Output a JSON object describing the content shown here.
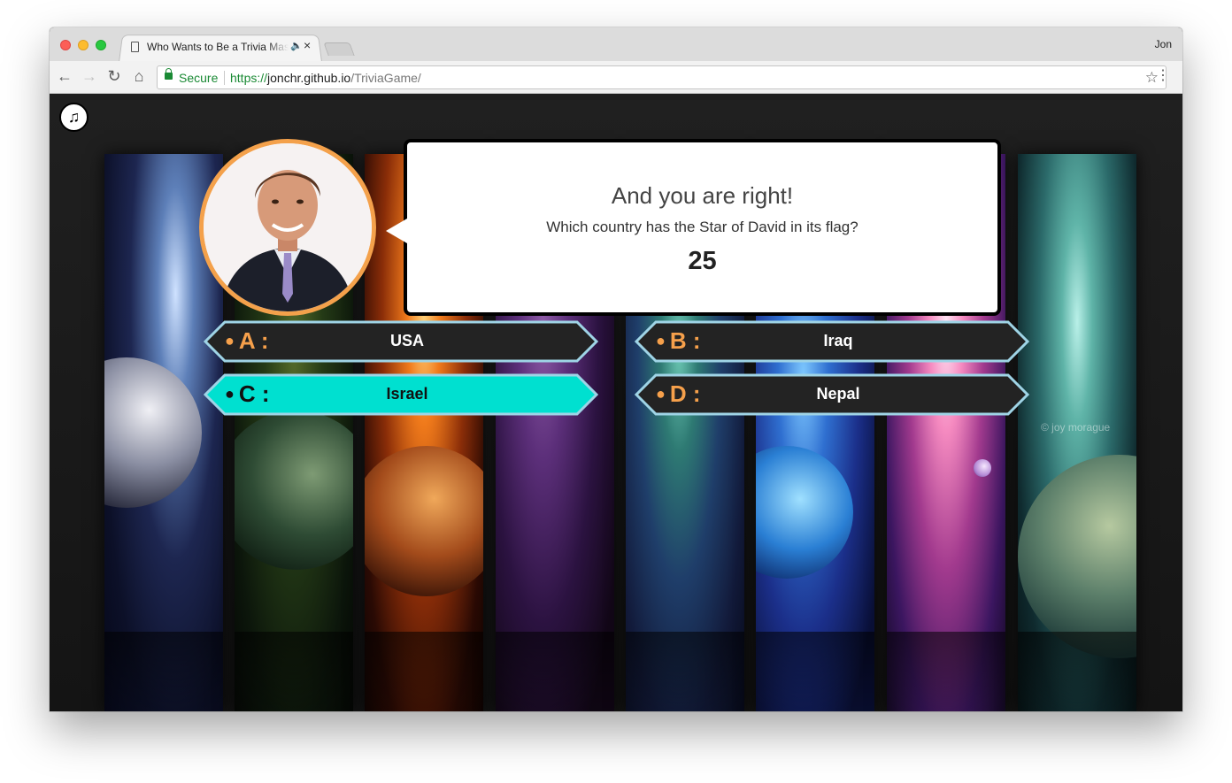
{
  "browser": {
    "tab_title": "Who Wants to Be a Trivia Master",
    "profile_name": "Jon",
    "secure_label": "Secure",
    "url_scheme": "https://",
    "url_host": "jonchr.github.io",
    "url_path": "/TriviaGame/"
  },
  "game": {
    "status": "And you are right!",
    "question": "Which country has the Star of David in its flag?",
    "timer": "25",
    "answers": [
      {
        "letter": "A :",
        "text": "USA"
      },
      {
        "letter": "B :",
        "text": "Iraq"
      },
      {
        "letter": "C :",
        "text": "Israel"
      },
      {
        "letter": "D :",
        "text": "Nepal"
      }
    ],
    "correct_answer_index": 2,
    "watermark": "© joy morague"
  },
  "colors": {
    "accent_orange": "#f6a04b",
    "correct_fill": "#00e0d0",
    "answer_fill": "#232323",
    "answer_border": "#9fd4e6"
  },
  "icons": {
    "music": "music-note-icon"
  }
}
